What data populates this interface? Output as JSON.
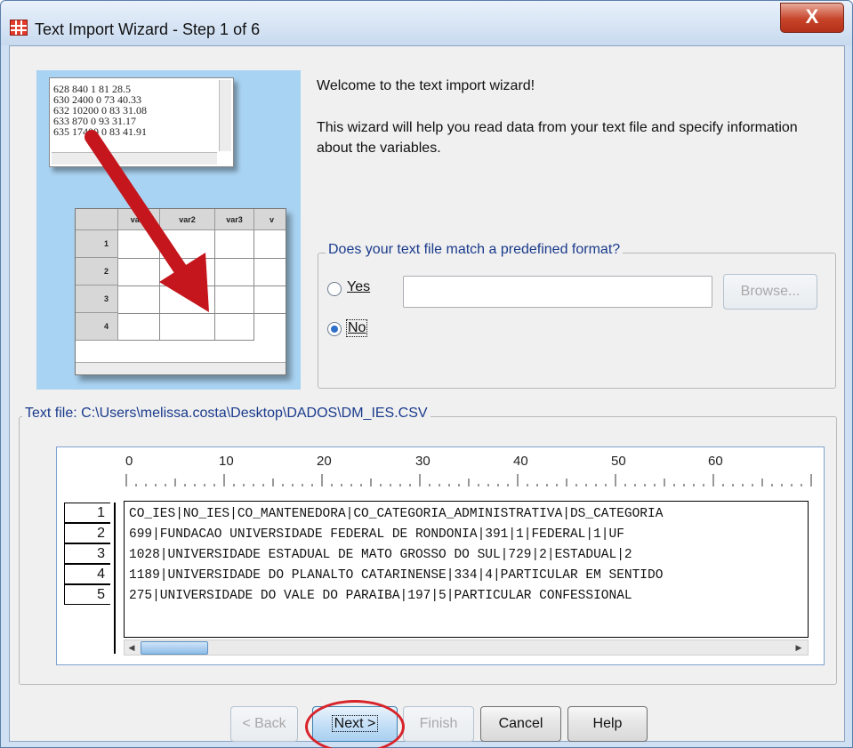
{
  "window": {
    "title": "Text Import Wizard - Step 1 of 6",
    "close_label": "X"
  },
  "illustration": {
    "text_lines": [
      "628 840 1 81 28.5",
      "630 2400 0 73 40.33",
      "632 10200 0 83 31.08",
      "633 870 0 93 31.17",
      "635 17400 0 83 41.91"
    ],
    "columns": [
      "var1",
      "var2",
      "var3",
      "v"
    ],
    "rows": [
      "1",
      "2",
      "3",
      "4"
    ]
  },
  "intro": {
    "welcome": "Welcome to the text import wizard!",
    "description": "This wizard will help you read data from your text file and specify information about the variables."
  },
  "format_group": {
    "legend": "Does your text file match a predefined format?",
    "yes_label": "Yes",
    "no_label": "No",
    "selected": "No",
    "path_value": "",
    "browse_label": "Browse..."
  },
  "preview": {
    "legend": "Text file:  C:\\Users\\melissa.costa\\Desktop\\DADOS\\DM_IES.CSV",
    "ruler_numbers": [
      "0",
      "10",
      "20",
      "30",
      "40",
      "50",
      "60"
    ],
    "row_numbers": [
      "1",
      "2",
      "3",
      "4",
      "5"
    ],
    "lines": [
      "CO_IES|NO_IES|CO_MANTENEDORA|CO_CATEGORIA_ADMINISTRATIVA|DS_CATEGORIA",
      "699|FUNDACAO UNIVERSIDADE FEDERAL DE RONDONIA|391|1|FEDERAL|1|UF",
      "1028|UNIVERSIDADE ESTADUAL DE MATO GROSSO DO SUL|729|2|ESTADUAL|2",
      "1189|UNIVERSIDADE DO PLANALTO CATARINENSE|334|4|PARTICULAR EM SENTIDO",
      "275|UNIVERSIDADE DO VALE DO PARAIBA|197|5|PARTICULAR CONFESSIONAL"
    ]
  },
  "buttons": {
    "back": "< Back",
    "next": "Next >",
    "finish": "Finish",
    "cancel": "Cancel",
    "help": "Help"
  },
  "colors": {
    "accent": "#1a3a8c",
    "highlight": "#d8232a",
    "illustration_bg": "#a9d3f2"
  }
}
